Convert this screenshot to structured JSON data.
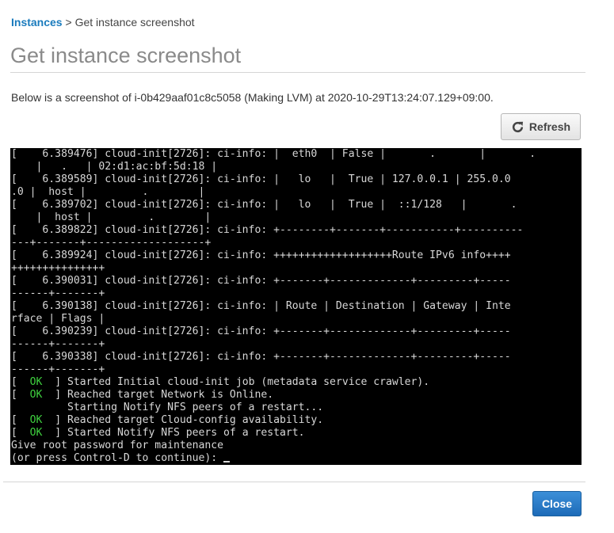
{
  "breadcrumb": {
    "link": "Instances",
    "separator": " > ",
    "current": "Get instance screenshot"
  },
  "page": {
    "title": "Get instance screenshot",
    "description": "Below is a screenshot of i-0b429aaf01c8c5058 (Making LVM) at 2020-10-29T13:24:07.129+09:00."
  },
  "toolbar": {
    "refresh_label": "Refresh",
    "refresh_icon": "refresh-icon"
  },
  "console": {
    "lines": [
      "[    6.389476] cloud-init[2726]: ci-info: |  eth0  | False |       .       |       .",
      "    |   .   | 02:d1:ac:bf:5d:18 |",
      "[    6.389589] cloud-init[2726]: ci-info: |   lo   |  True | 127.0.0.1 | 255.0.0",
      ".0 |  host |         .        |",
      "[    6.389702] cloud-init[2726]: ci-info: |   lo   |  True |  ::1/128   |       .",
      "    |  host |         .        |",
      "[    6.389822] cloud-init[2726]: ci-info: +--------+-------+-----------+----------",
      "---+-------+-------------------+",
      "[    6.389924] cloud-init[2726]: ci-info: +++++++++++++++++++Route IPv6 info++++",
      "+++++++++++++++",
      "[    6.390031] cloud-init[2726]: ci-info: +-------+-------------+---------+-----",
      "------+-------+",
      "[    6.390138] cloud-init[2726]: ci-info: | Route | Destination | Gateway | Inte",
      "rface | Flags |",
      "[    6.390239] cloud-init[2726]: ci-info: +-------+-------------+---------+-----",
      "------+-------+",
      "[    6.390338] cloud-init[2726]: ci-info: +-------+-------------+---------+-----",
      "------+-------+"
    ],
    "service_lines": [
      {
        "ok": "  OK  ",
        "text": "] Started Initial cloud-init job (metadata service crawler)."
      },
      {
        "ok": "  OK  ",
        "text": "] Reached target Network is Online."
      },
      {
        "ok": "",
        "text": "         Starting Notify NFS peers of a restart..."
      },
      {
        "ok": "  OK  ",
        "text": "] Reached target Cloud-config availability."
      },
      {
        "ok": "  OK  ",
        "text": "] Started Notify NFS peers of a restart."
      }
    ],
    "prompt_lines": [
      "Give root password for maintenance",
      "(or press Control-D to continue): "
    ]
  },
  "footer": {
    "close_label": "Close"
  }
}
